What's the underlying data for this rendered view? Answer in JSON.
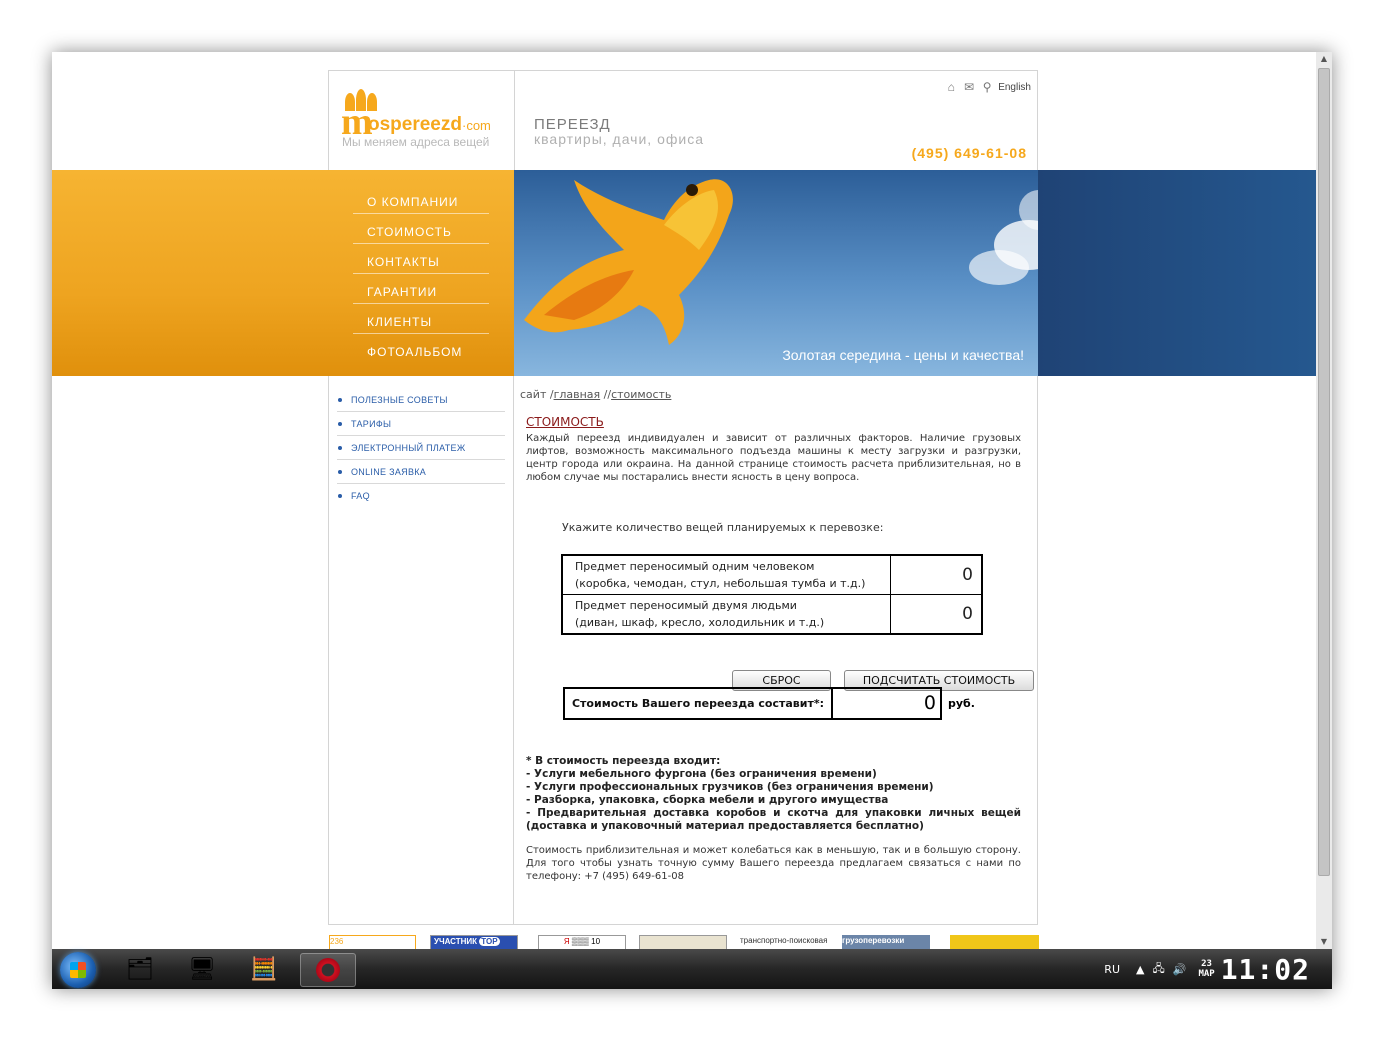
{
  "header": {
    "logo_word": "ospereezd",
    "logo_domain": "·com",
    "logo_slogan": "Мы меняем адреса вещей",
    "top_links": {
      "english": "English"
    },
    "tagline_line1": "ПЕРЕЕЗД",
    "tagline_line2": "квартиры, дачи, офиса",
    "phone": "(495) 649-61-08"
  },
  "main_menu": {
    "items": [
      "О КОМПАНИИ",
      "СТОИМОСТЬ",
      "КОНТАКТЫ",
      "ГАРАНТИИ",
      "КЛИЕНТЫ",
      "ФОТОАЛЬБОМ"
    ]
  },
  "banner": {
    "caption": "Золотая середина - цены и качества!"
  },
  "sub_menu": {
    "items": [
      "ПОЛЕЗНЫЕ СОВЕТЫ",
      "ТАРИФЫ",
      "ЭЛЕКТРОННЫЙ ПЛАТЕЖ",
      "ONLINE ЗАЯВКА",
      "FAQ"
    ]
  },
  "breadcrumb": {
    "prefix": "сайт /",
    "link1": "главная",
    "sep": " /",
    "link2": "стоимость"
  },
  "page": {
    "title": "СТОИМОСТЬ",
    "intro": "Каждый переезд индивидуален и зависит от различных факторов. Наличие грузовых лифтов, возможность максимального подъезда машины к месту загрузки и разгрузки, центр города или окраина. На данной странице стоимость расчета приблизительная, но в любом случае мы постарались внести ясность в цену вопроса."
  },
  "calculator": {
    "prompt": "Укажите количество вещей планируемых к перевозке:",
    "rows": [
      {
        "line1": "Предмет переносимый одним человеком",
        "line2": "(коробка, чемодан, стул, небольшая  тумба и т.д.)",
        "value": "0"
      },
      {
        "line1": "Предмет переносимый двумя людьми",
        "line2": "(диван, шкаф, кресло, холодильник и т.д.)",
        "value": "0"
      }
    ],
    "reset_label": "СБРОС",
    "calc_label": "ПОДСЧИТАТЬ СТОИМОСТЬ",
    "result_label": "Стоимость Вашего переезда составит*:",
    "result_value": "0",
    "result_unit": "руб."
  },
  "notes": [
    "* В стоимость переезда входит:",
    "- Услуги мебельного фургона (без ограничения времени)",
    "- Услуги профессиональных грузчиков (без ограничения времени)",
    "- Разборка, упаковка, сборка мебели и другого имущества",
    "- Предварительная доставка коробов и скотча для упаковки личных вещей (доставка и упаковочный материал предоставляется бесплатно)"
  ],
  "footnote": "Стоимость приблизительная и может колебаться как в меньшую, так и в большую сторону. Для того чтобы узнать точную сумму Вашего переезда предлагаем связаться с нами по телефону: +7 (495) 649-61-08",
  "banners": {
    "b1": "236",
    "b2": "УЧАСТНИК",
    "b2b": "TOP",
    "b3": "10",
    "b5": "транспортно-поисковая",
    "b6": "грузоперевозки"
  },
  "taskbar": {
    "lang": "RU",
    "date_day": "23",
    "date_month": "МАР",
    "time": "11:02"
  }
}
